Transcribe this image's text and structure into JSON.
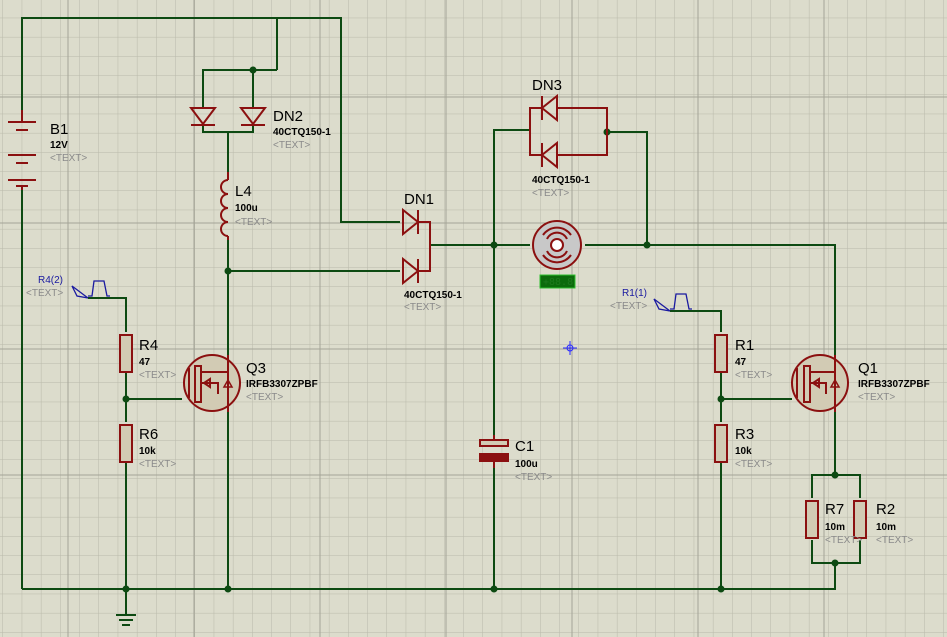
{
  "colors": {
    "background": "#dcdccc",
    "wire": "#0d4a12",
    "component": "#8b1010",
    "generator": "#1a1aa0",
    "readout_bg": "#0b6b0b"
  },
  "components": {
    "B1": {
      "ref": "B1",
      "value": "12V",
      "text": "<TEXT>"
    },
    "DN2": {
      "ref": "DN2",
      "value": "40CTQ150-1",
      "text": "<TEXT>"
    },
    "L4": {
      "ref": "L4",
      "value": "100u",
      "text": "<TEXT>"
    },
    "DN1": {
      "ref": "DN1",
      "value": "40CTQ150-1",
      "text": "<TEXT>"
    },
    "DN3": {
      "ref": "DN3",
      "value": "40CTQ150-1",
      "text": "<TEXT>"
    },
    "R4": {
      "ref": "R4",
      "value": "47",
      "text": "<TEXT>"
    },
    "R6": {
      "ref": "R6",
      "value": "10k",
      "text": "<TEXT>"
    },
    "Q3": {
      "ref": "Q3",
      "value": "IRFB3307ZPBF",
      "text": "<TEXT>"
    },
    "C1": {
      "ref": "C1",
      "value": "100u",
      "text": "<TEXT>"
    },
    "R1": {
      "ref": "R1",
      "value": "47",
      "text": "<TEXT>"
    },
    "R3": {
      "ref": "R3",
      "value": "10k",
      "text": "<TEXT>"
    },
    "Q1": {
      "ref": "Q1",
      "value": "IRFB3307ZPBF",
      "text": "<TEXT>"
    },
    "R7": {
      "ref": "R7",
      "value": "10m",
      "text": "<TEXT>"
    },
    "R2": {
      "ref": "R2",
      "value": "10m",
      "text": "<TEXT>"
    }
  },
  "generators": {
    "R4_2": {
      "label": "R4(2)",
      "text": "<TEXT>",
      "icon": "pulse-generator-icon"
    },
    "R1_1": {
      "label": "R1(1)",
      "text": "<TEXT>",
      "icon": "pulse-generator-icon"
    }
  },
  "motor": {
    "icon": "dc-motor-icon",
    "readout": "+88.8"
  }
}
